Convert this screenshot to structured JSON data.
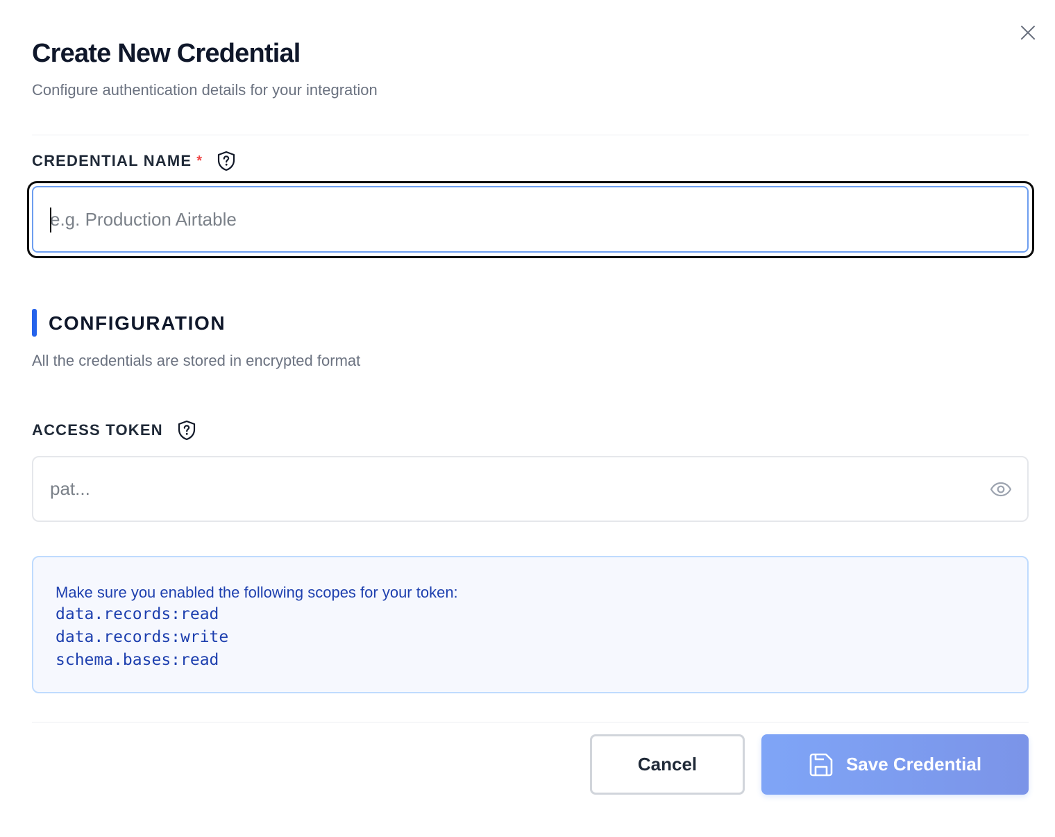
{
  "dialog": {
    "title": "Create New Credential",
    "subtitle": "Configure authentication details for your integration",
    "close_icon": "close-icon"
  },
  "credential_name": {
    "label": "CREDENTIAL NAME",
    "required_marker": "*",
    "help_icon": "shield-question-icon",
    "value": "",
    "placeholder": "e.g. Production Airtable"
  },
  "configuration": {
    "title": "CONFIGURATION",
    "description": "All the credentials are stored in encrypted format"
  },
  "access_token": {
    "label": "ACCESS TOKEN",
    "help_icon": "shield-question-icon",
    "value": "",
    "placeholder": "pat...",
    "visibility_icon": "eye-icon"
  },
  "scopes_info": {
    "text": "Make sure you enabled the following scopes for your token:",
    "scopes": [
      "data.records:read",
      "data.records:write",
      "schema.bases:read"
    ]
  },
  "footer": {
    "cancel_label": "Cancel",
    "save_label": "Save Credential",
    "save_icon": "save-icon"
  },
  "colors": {
    "accent": "#2563eb",
    "required": "#ef4444",
    "info_text": "#1e40af",
    "info_background": "#f6f8fe",
    "save_button": "#7fa5f7"
  }
}
